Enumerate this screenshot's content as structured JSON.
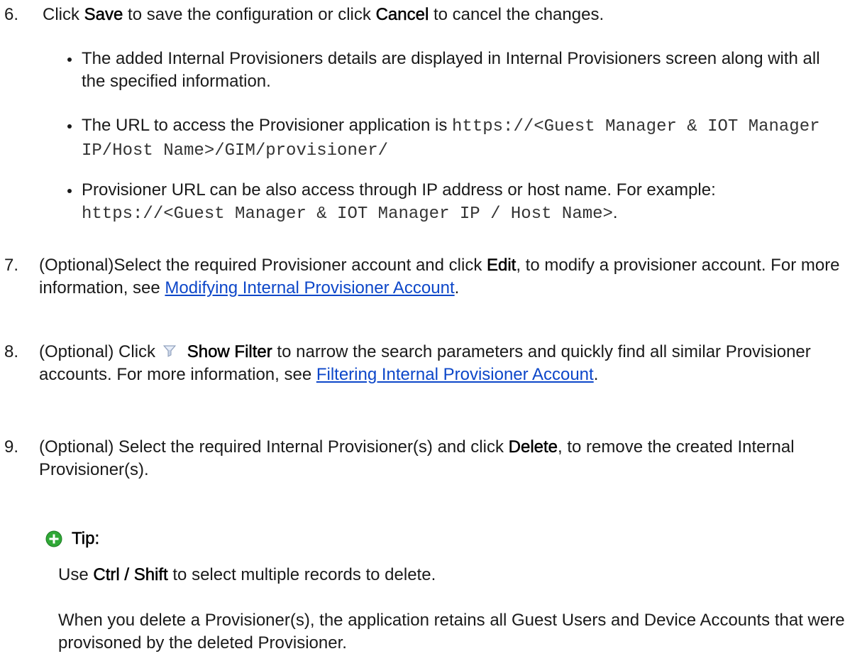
{
  "step6": {
    "num": "6.",
    "t1": "Click ",
    "save": "Save",
    "t2": " to save the configuration or click ",
    "cancel": "Cancel",
    "t3": " to cancel the changes.",
    "bullet1": "The added Internal Provisioners details are displayed in Internal Provisioners screen along with all the specified information.",
    "bullet2_text": "The URL to access the Provisioner application is ",
    "bullet2_url": "https://<Guest Manager & IOT Manager IP/Host Name>/GIM/provisioner/",
    "bullet3_text": "Provisioner URL can be also access through IP address or host name. For example: ",
    "bullet3_url": "https://<Guest Manager & IOT Manager IP / Host Name>",
    "bullet3_end": "."
  },
  "step7": {
    "num": "7.",
    "t1": " (Optional)Select the required Provisioner account and click ",
    "edit": "Edit",
    "t2": ", to modify a provisioner account. For more information, see ",
    "link": "Modifying Internal Provisioner Account",
    "t3": "."
  },
  "step8": {
    "num": "8.",
    "t1": " (Optional) Click ",
    "icon": "filter-icon",
    "show_filter": "Show Filter",
    "t2": " to narrow the search parameters and quickly find all similar Provisioner accounts. For more information, see ",
    "link": "Filtering Internal Provisioner Account",
    "t3": "."
  },
  "step9": {
    "num": "9.",
    "t1": " (Optional) Select the required Internal Provisioner(s) and click ",
    "delete": "Delete",
    "t2": ", to remove the created Internal Provisioner(s)."
  },
  "tip": {
    "icon": "plus-circle-icon",
    "label": "Tip:",
    "p1_t1": "Use ",
    "p1_keys": "Ctrl / Shift",
    "p1_t2": " to select multiple records to delete.",
    "p2": "When you delete a Provisioner(s), the application retains all Guest Users and Device Accounts that were provisoned by the deleted Provisioner."
  },
  "colors": {
    "link": "#0d47c9",
    "tip_icon": "#2fa836"
  }
}
